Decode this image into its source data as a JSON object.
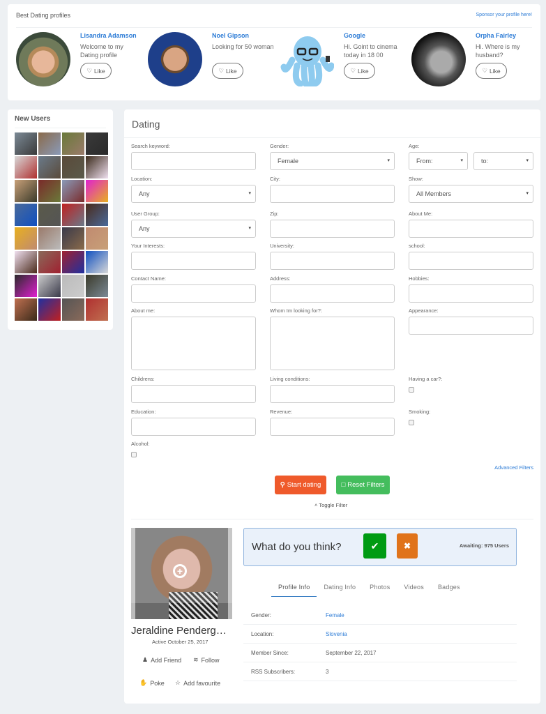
{
  "top": {
    "title": "Best Dating profiles",
    "sponsor_link": "Sponsor your profile here!",
    "profiles": [
      {
        "name": "Lisandra Adamson",
        "message": "Welcome to my Dating profile",
        "like_label": "Like"
      },
      {
        "name": "Noel Gipson",
        "message": "Looking for 50 woman",
        "like_label": "Like"
      },
      {
        "name": "Google",
        "message": "Hi. Goint to cinema today in 18 00",
        "like_label": "Like"
      },
      {
        "name": "Orpha Fairley",
        "message": "Hi. Where is my husband?",
        "like_label": "Like"
      }
    ]
  },
  "new_users": {
    "title": "New Users",
    "count": 32
  },
  "dating": {
    "title": "Dating",
    "fields": {
      "search_keyword": {
        "label": "Search keyword:",
        "value": ""
      },
      "gender": {
        "label": "Gender:",
        "value": "Female"
      },
      "age": {
        "label": "Age:",
        "from": "From:",
        "to": "to:"
      },
      "location": {
        "label": "Location:",
        "value": "Any"
      },
      "city": {
        "label": "City:",
        "value": ""
      },
      "show": {
        "label": "Show:",
        "value": "All Members"
      },
      "user_group": {
        "label": "User Group:",
        "value": "Any"
      },
      "zip": {
        "label": "Zip:",
        "value": ""
      },
      "about_me_short": {
        "label": "About Me:",
        "value": ""
      },
      "interests": {
        "label": "Your Interests:",
        "value": ""
      },
      "university": {
        "label": "University:",
        "value": ""
      },
      "school": {
        "label": "school:",
        "value": ""
      },
      "contact_name": {
        "label": "Contact Name:",
        "value": ""
      },
      "address": {
        "label": "Address:",
        "value": ""
      },
      "hobbies": {
        "label": "Hobbies:",
        "value": ""
      },
      "about_me": {
        "label": "About me:",
        "value": ""
      },
      "looking_for": {
        "label": "Whom Im looking for?:",
        "value": ""
      },
      "appearance": {
        "label": "Appearance:",
        "value": ""
      },
      "childrens": {
        "label": "Childrens:",
        "value": ""
      },
      "living": {
        "label": "Living conditions:",
        "value": ""
      },
      "car": {
        "label": "Having a car?:",
        "checked": false
      },
      "education": {
        "label": "Education:",
        "value": ""
      },
      "revenue": {
        "label": "Revenue:",
        "value": ""
      },
      "smoking": {
        "label": "Smoking:",
        "checked": false
      },
      "alcohol": {
        "label": "Alcohol:",
        "checked": false
      }
    },
    "advanced_filters": "Advanced Filters",
    "start_label": "Start dating",
    "reset_label": "Reset Filters",
    "toggle_label": "Toggle Filter"
  },
  "profile": {
    "name": "Jeraldine Penderg…",
    "active": "Active October 25, 2017",
    "actions": {
      "add_friend": "Add Friend",
      "follow": "Follow",
      "poke": "Poke",
      "favourite": "Add favourite"
    },
    "think": {
      "question": "What do you think?",
      "awaiting": "Awaiting: 975 Users"
    },
    "tabs": [
      "Profile Info",
      "Dating Info",
      "Photos",
      "Videos",
      "Badges"
    ],
    "active_tab": "Profile Info",
    "info": [
      {
        "key": "Gender:",
        "value": "Female",
        "link": true
      },
      {
        "key": "Location:",
        "value": "Slovenia",
        "link": true
      },
      {
        "key": "Member Since:",
        "value": "September 22, 2017",
        "link": false
      },
      {
        "key": "RSS Subscribers:",
        "value": "3",
        "link": false
      }
    ]
  },
  "colors": {
    "link": "#2d7cd6",
    "start": "#ef5a2b",
    "reset": "#44bd5d",
    "yes": "#009b13",
    "no": "#e0731a"
  }
}
